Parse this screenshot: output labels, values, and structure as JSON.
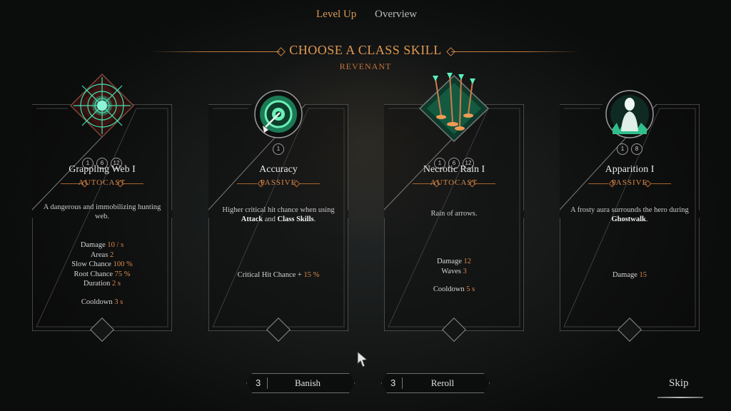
{
  "tabs": [
    {
      "label": "Level Up",
      "active": true
    },
    {
      "label": "Overview",
      "active": false
    }
  ],
  "header": {
    "title": "CHOOSE A CLASS SKILL",
    "subtitle": "REVENANT"
  },
  "cards": [
    {
      "title": "Grappling Web I",
      "type": "AUTOCAST",
      "icon": "spider-web-icon",
      "levels": [
        "1",
        "6",
        "12"
      ],
      "description": "A dangerous and immobilizing hunting web.",
      "stats": [
        {
          "label": "Damage",
          "value": "10 / s"
        },
        {
          "label": "Areas",
          "value": "2"
        },
        {
          "label": "Slow Chance",
          "value": "100 %"
        },
        {
          "label": "Root Chance",
          "value": "75 %"
        },
        {
          "label": "Duration",
          "value": "2 s"
        }
      ],
      "cooldown": {
        "label": "Cooldown",
        "value": "3 s"
      }
    },
    {
      "title": "Accuracy",
      "type": "PASSIVE",
      "icon": "arrow-target-icon",
      "levels": [
        "1"
      ],
      "description_parts": [
        "Higher critical hit chance when using ",
        "Attack",
        " and ",
        "Class Skills",
        "."
      ],
      "stats": [
        {
          "label": "Critical Hit Chance +",
          "value": "15 %"
        }
      ]
    },
    {
      "title": "Necrotic Rain I",
      "type": "AUTOCAST",
      "icon": "arrow-rain-icon",
      "levels": [
        "1",
        "6",
        "12"
      ],
      "description": "Rain of arrows.",
      "stats": [
        {
          "label": "Damage",
          "value": "12"
        },
        {
          "label": "Waves",
          "value": "3"
        }
      ],
      "cooldown": {
        "label": "Cooldown",
        "value": "5 s"
      }
    },
    {
      "title": "Apparition I",
      "type": "PASSIVE",
      "icon": "ghost-figure-icon",
      "levels": [
        "1",
        "8"
      ],
      "description_parts": [
        "A frosty aura surrounds the hero during ",
        "Ghostwalk",
        "."
      ],
      "stats": [
        {
          "label": "Damage",
          "value": "15"
        }
      ]
    }
  ],
  "actions": {
    "banish": {
      "count": "3",
      "label": "Banish"
    },
    "reroll": {
      "count": "3",
      "label": "Reroll"
    },
    "skip": "Skip"
  },
  "colors": {
    "accent": "#e39a52",
    "value": "#de8a4a",
    "icon_glow": "#3fe0b0"
  }
}
